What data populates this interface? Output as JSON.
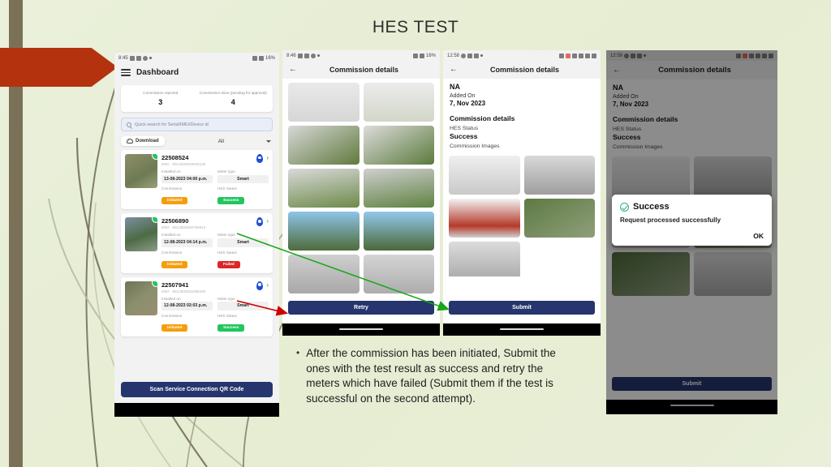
{
  "slide": {
    "title": "HES TEST",
    "accent_red": "#b5320f",
    "background": "#e8eed5",
    "bullet_marker": "•",
    "bullet_text": "After the commission has been initiated, Submit the ones with the test result as success and retry the meters which have failed (Submit them if the test is successful on the second attempt)."
  },
  "phone1": {
    "statusbar": {
      "time": "8:45",
      "battery": "16%"
    },
    "nav": {
      "menu_icon": "hamburger-icon",
      "title": "Dashboard"
    },
    "kpis": [
      {
        "label": "Commission rejected",
        "value": "3"
      },
      {
        "label": "Commission done (pending for approval)",
        "value": "4"
      }
    ],
    "search": {
      "icon": "search-icon",
      "placeholder": "Quick search for Serial/IMEI/Device id"
    },
    "filters": {
      "download_label": "Download",
      "download_icon": "cloud-download-icon",
      "select_value": "All",
      "caret_icon": "chevron-down-icon"
    },
    "list_labels": {
      "installed_on": "Installed on",
      "meter_type": "Meter type",
      "commission": "Commission",
      "hes_status": "HES Status"
    },
    "meters": [
      {
        "serial": "22508524",
        "imei": "IMEI - 8613400528500195",
        "installed_on": "13-08-2023 04:00 p.m.",
        "meter_type": "Smart",
        "commission": "Initiated",
        "hes_status": "Success",
        "hes_color": "green"
      },
      {
        "serial": "22506890",
        "imei": "IMEI - 8613600630799915",
        "installed_on": "12-08-2023 04:14 p.m.",
        "meter_type": "Smart",
        "commission": "Initiated",
        "hes_status": "Failed",
        "hes_color": "red"
      },
      {
        "serial": "22507941",
        "imei": "IMEI - 8613800520366490",
        "installed_on": "12-08-2023 02:03 p.m.",
        "meter_type": "Smart",
        "commission": "Initiated",
        "hes_status": "Success",
        "hes_color": "green"
      }
    ],
    "qr_button": "Scan Service Connection QR Code"
  },
  "phone2": {
    "statusbar": {
      "time": "8:46",
      "battery": "16%"
    },
    "nav": {
      "back_icon": "back-arrow-icon",
      "title": "Commission details"
    },
    "image_count": 10,
    "primary_button": "Retry"
  },
  "phone3": {
    "statusbar": {
      "time": "12:58",
      "battery": ""
    },
    "nav": {
      "back_icon": "back-arrow-icon",
      "title": "Commission details"
    },
    "consumer_name": "NA",
    "added_on_label": "Added On",
    "added_on_value": "7, Nov 2023",
    "section_title": "Commission details",
    "hes_status_label": "HES Status",
    "hes_status_value": "Success",
    "images_label": "Commission Images",
    "image_count": 5,
    "primary_button": "Submit"
  },
  "phone4": {
    "statusbar": {
      "time": "12:58",
      "battery": ""
    },
    "nav": {
      "back_icon": "back-arrow-icon",
      "title": "Commission details"
    },
    "consumer_name": "NA",
    "added_on_label": "Added On",
    "added_on_value": "7, Nov 2023",
    "section_title": "Commission details",
    "hes_status_label": "HES Status",
    "hes_status_value": "Success",
    "images_label": "Commission Images",
    "primary_button": "Submit",
    "dialog": {
      "icon": "check-circle-icon",
      "title": "Success",
      "message": "Request processed successfully",
      "ok_label": "OK"
    }
  },
  "annotations": {
    "green_arrow": {
      "color": "#18a718",
      "from": "phone1-success-badge",
      "to": "phone3-submit-button"
    },
    "red_arrow": {
      "color": "#cc0000",
      "from": "phone1-failed-badge",
      "to": "phone2-retry-button"
    }
  }
}
